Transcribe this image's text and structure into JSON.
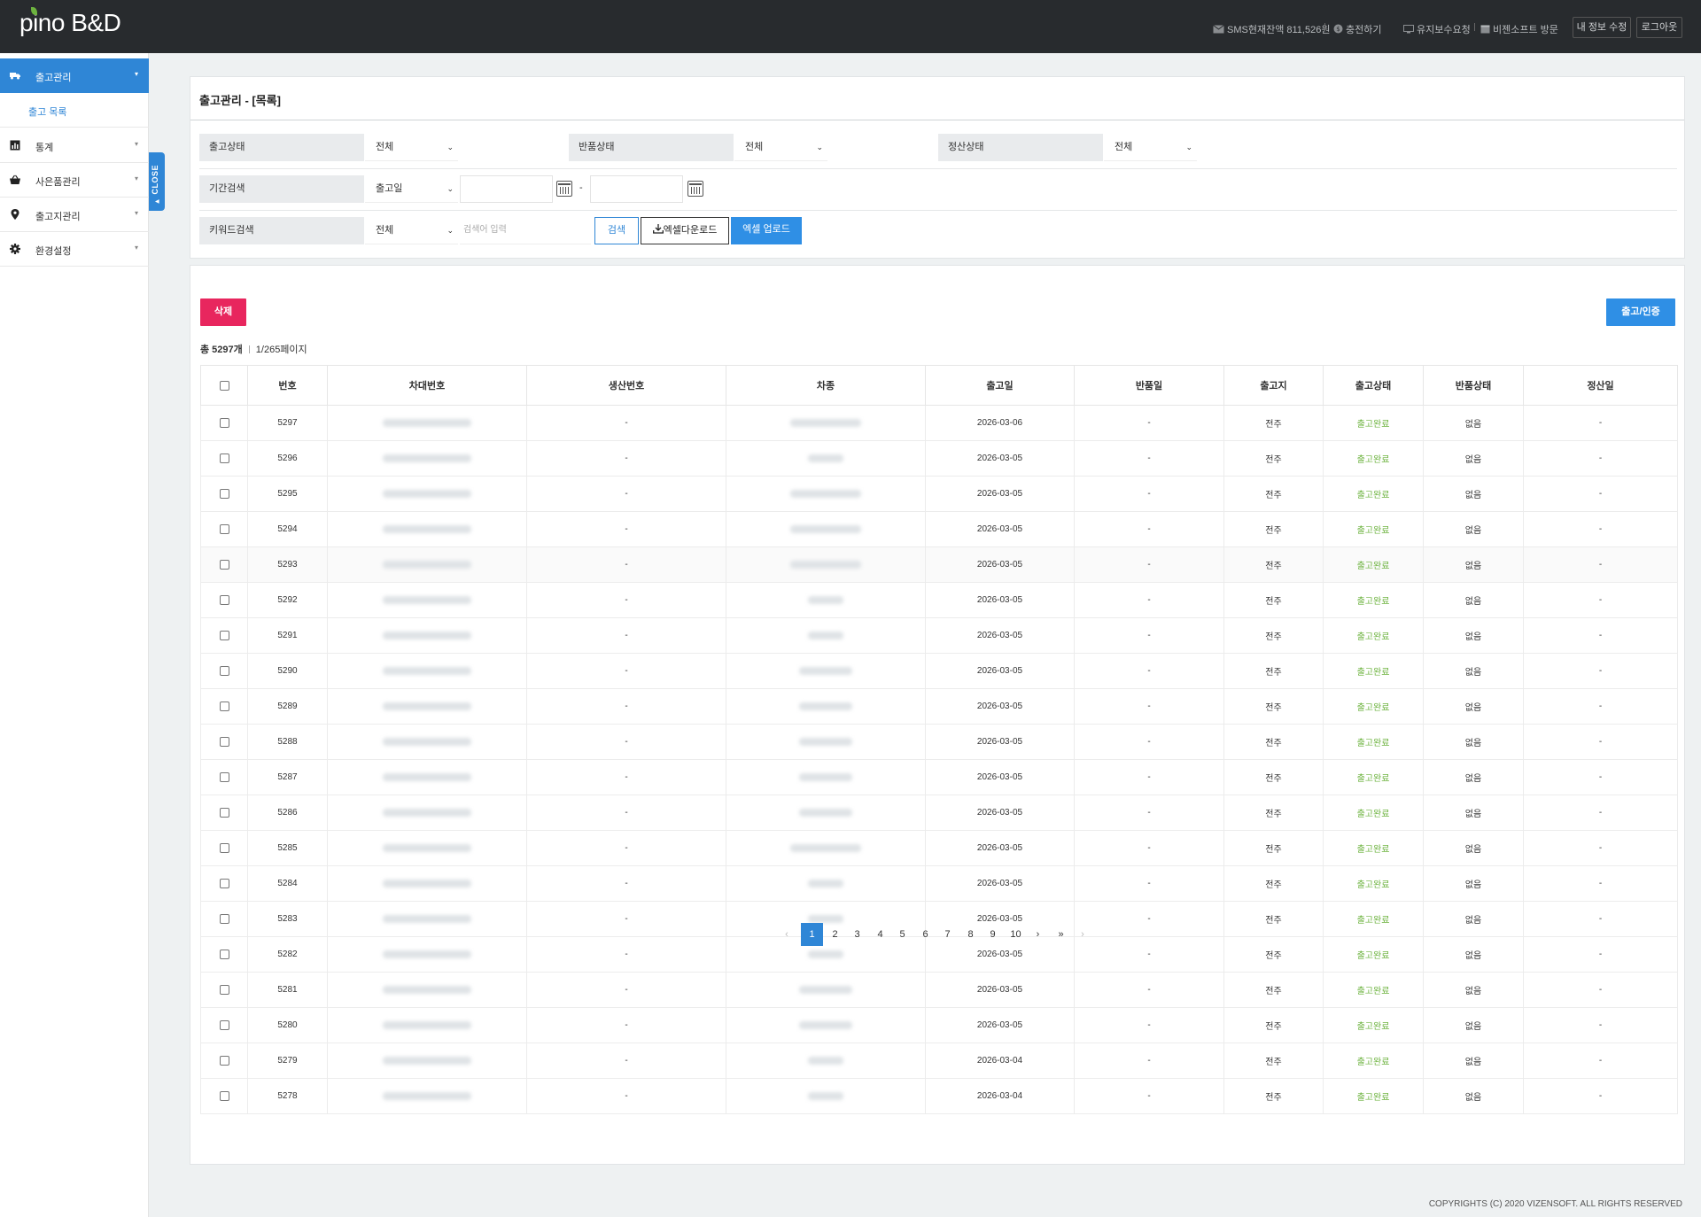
{
  "header": {
    "logo": "pino B&D",
    "sms_balance": "SMS현재잔액 811,526원",
    "recharge": "충전하기",
    "maintenance": "유지보수요청",
    "visit": "비젠소프트 방문",
    "edit_info": "내 정보 수정",
    "logout": "로그아웃"
  },
  "sidebar": {
    "items": [
      {
        "label": "출고관리",
        "icon": "truck-icon"
      },
      {
        "label": "통계",
        "icon": "chart-icon"
      },
      {
        "label": "사은품관리",
        "icon": "basket-icon"
      },
      {
        "label": "출고지관리",
        "icon": "map-pin-icon"
      },
      {
        "label": "환경설정",
        "icon": "gear-icon"
      }
    ],
    "sub_item": "출고 목록",
    "close": "CLOSE"
  },
  "search": {
    "title": "출고관리 - [목록]",
    "ship_status_label": "출고상태",
    "ship_status_value": "전체",
    "return_status_label": "반품상태",
    "return_status_value": "전체",
    "settle_status_label": "정산상태",
    "settle_status_value": "전체",
    "period_label": "기간검색",
    "period_type": "출고일",
    "date_sep": "-",
    "keyword_label": "키워드검색",
    "keyword_type": "전체",
    "keyword_placeholder": "검색어 입력",
    "search_btn": "검색",
    "excel_download": "엑셀다운로드",
    "excel_upload": "엑셀 업로드"
  },
  "list": {
    "delete_btn": "삭제",
    "out_btn": "출고/인증",
    "total": "총 5297개",
    "page_info": "1/265페이지",
    "columns": [
      "번호",
      "차대번호",
      "생산번호",
      "차종",
      "출고일",
      "반품일",
      "출고지",
      "출고상태",
      "반품상태",
      "정산일"
    ],
    "rows": [
      {
        "no": "5297",
        "date": "2026-03-06"
      },
      {
        "no": "5296",
        "date": "2026-03-05"
      },
      {
        "no": "5295",
        "date": "2026-03-05"
      },
      {
        "no": "5294",
        "date": "2026-03-05"
      },
      {
        "no": "5293",
        "date": "2026-03-05"
      },
      {
        "no": "5292",
        "date": "2026-03-05"
      },
      {
        "no": "5291",
        "date": "2026-03-05"
      },
      {
        "no": "5290",
        "date": "2026-03-05"
      },
      {
        "no": "5289",
        "date": "2026-03-05"
      },
      {
        "no": "5288",
        "date": "2026-03-05"
      },
      {
        "no": "5287",
        "date": "2026-03-05"
      },
      {
        "no": "5286",
        "date": "2026-03-05"
      },
      {
        "no": "5285",
        "date": "2026-03-05"
      },
      {
        "no": "5284",
        "date": "2026-03-05"
      },
      {
        "no": "5283",
        "date": "2026-03-05"
      },
      {
        "no": "5282",
        "date": "2026-03-05"
      },
      {
        "no": "5281",
        "date": "2026-03-05"
      },
      {
        "no": "5280",
        "date": "2026-03-05"
      },
      {
        "no": "5279",
        "date": "2026-03-04"
      },
      {
        "no": "5278",
        "date": "2026-03-04"
      }
    ],
    "production_no": "-",
    "return_date": "-",
    "location": "전주",
    "ship_status": "출고완료",
    "return_status": "없음",
    "settle_date": "-"
  },
  "pagination": {
    "prev": "‹",
    "pages": [
      "1",
      "2",
      "3",
      "4",
      "5",
      "6",
      "7",
      "8",
      "9",
      "10"
    ],
    "next": "›",
    "last": "»",
    "end": "›",
    "current": "1"
  },
  "footer": "COPYRIGHTS (C) 2020 VIZENSOFT. ALL RIGHTS RESERVED",
  "colors": {
    "accent": "#2f86d6",
    "delete": "#e8265e",
    "status_ok": "#6db33f",
    "header_bg": "#282b2e"
  }
}
